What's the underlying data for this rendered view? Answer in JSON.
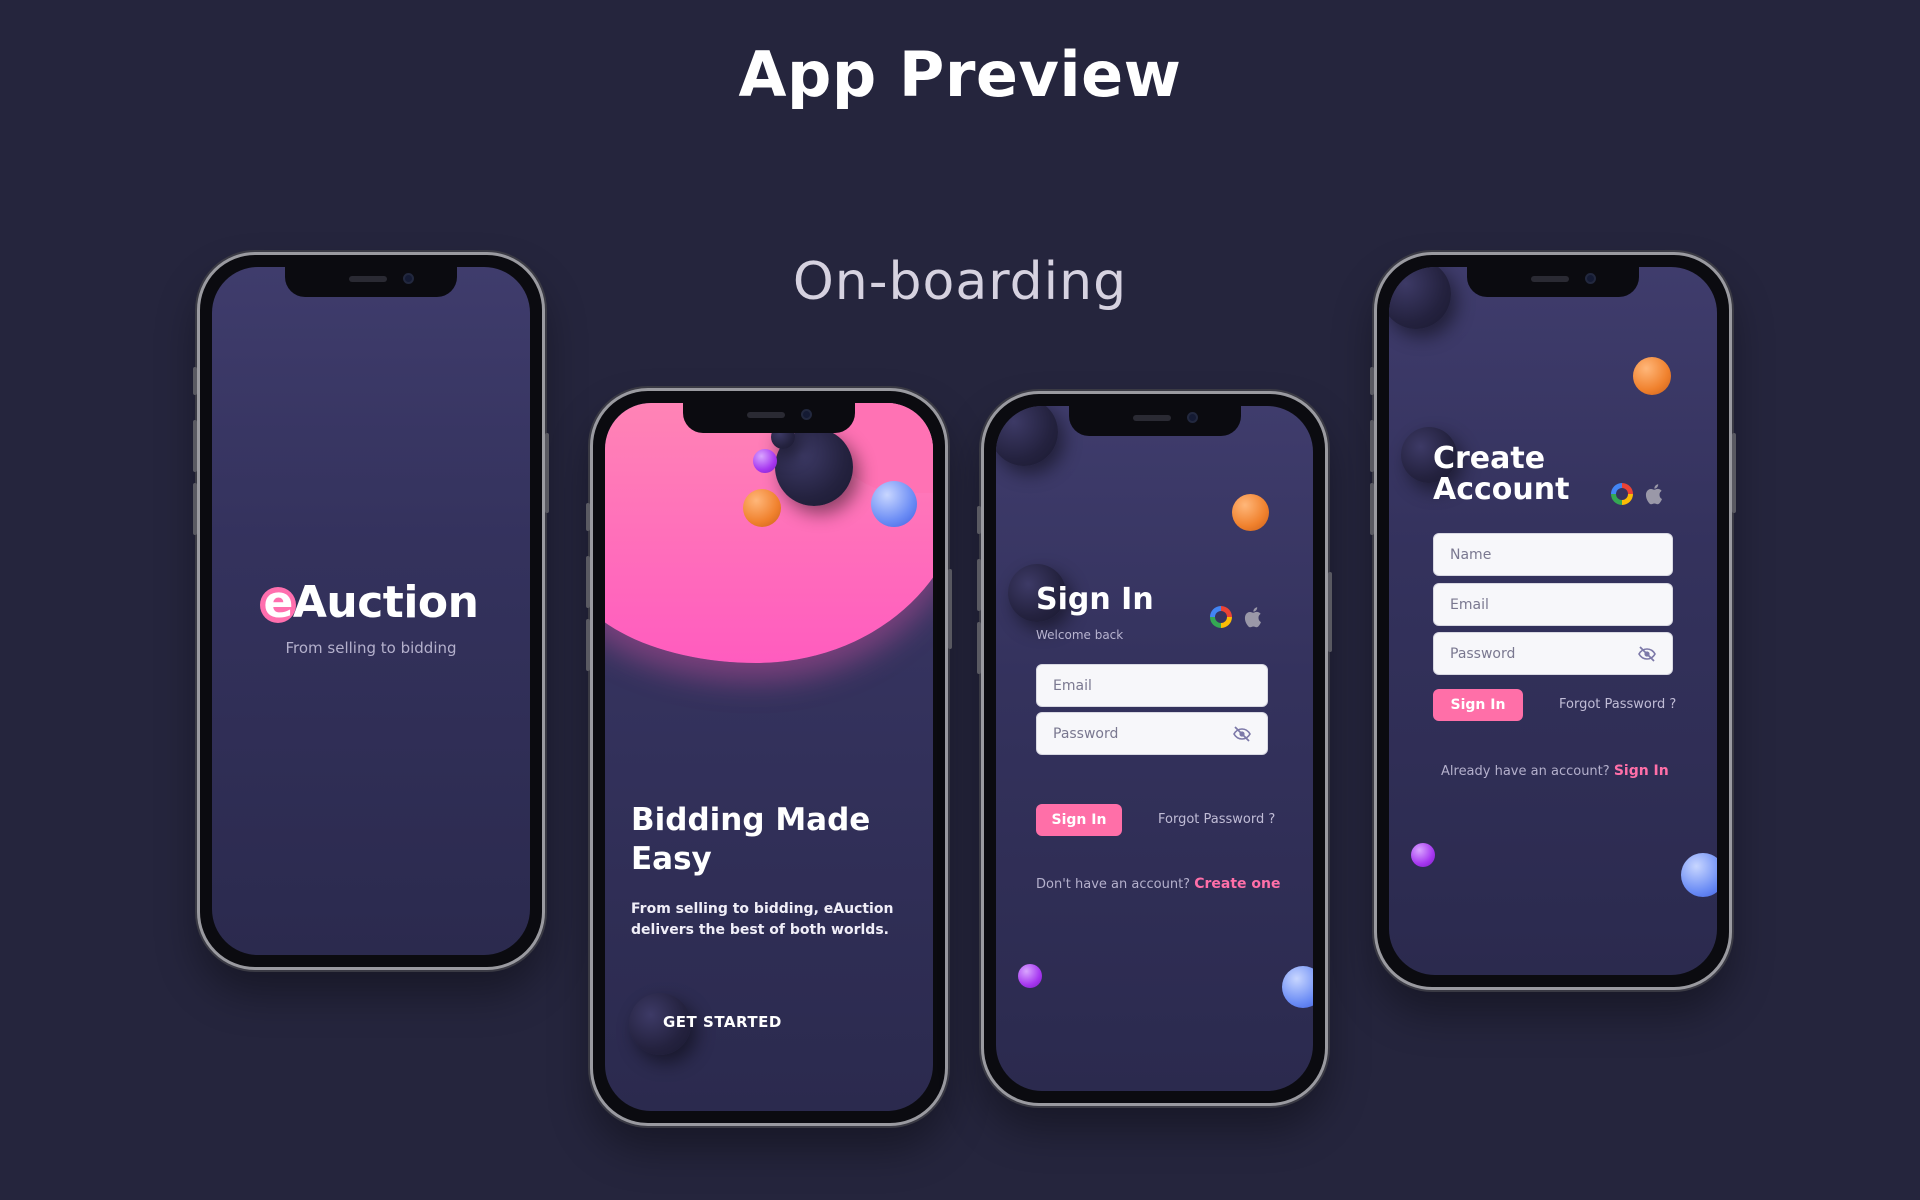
{
  "page": {
    "title": "App Preview",
    "section": "On-boarding"
  },
  "splash": {
    "logo_mark": "e",
    "logo_text": "Auction",
    "tagline": "From selling to bidding"
  },
  "intro": {
    "headline": "Bidding Made Easy",
    "subtext": "From selling to bidding, eAuction delivers the best of both worlds.",
    "cta": "GET STARTED"
  },
  "sign_in": {
    "title": "Sign In",
    "welcome": "Welcome back",
    "email_placeholder": "Email",
    "password_placeholder": "Password",
    "submit": "Sign In",
    "forgot": "Forgot Password ?",
    "footer_text": "Don't have an account?",
    "footer_link": "Create one",
    "social_icons": [
      "google-icon",
      "apple-icon"
    ]
  },
  "create_account": {
    "title_line1": "Create",
    "title_line2": "Account",
    "name_placeholder": "Name",
    "email_placeholder": "Email",
    "password_placeholder": "Password",
    "submit": "Sign In",
    "forgot": "Forgot Password ?",
    "footer_text": "Already have an account?",
    "footer_link": "Sign In",
    "social_icons": [
      "google-icon",
      "apple-icon"
    ]
  },
  "colors": {
    "background": "#25253d",
    "accent_pink": "#ff6fa8",
    "screen_top": "#3f3c6c",
    "screen_bottom": "#2b2a4e"
  }
}
